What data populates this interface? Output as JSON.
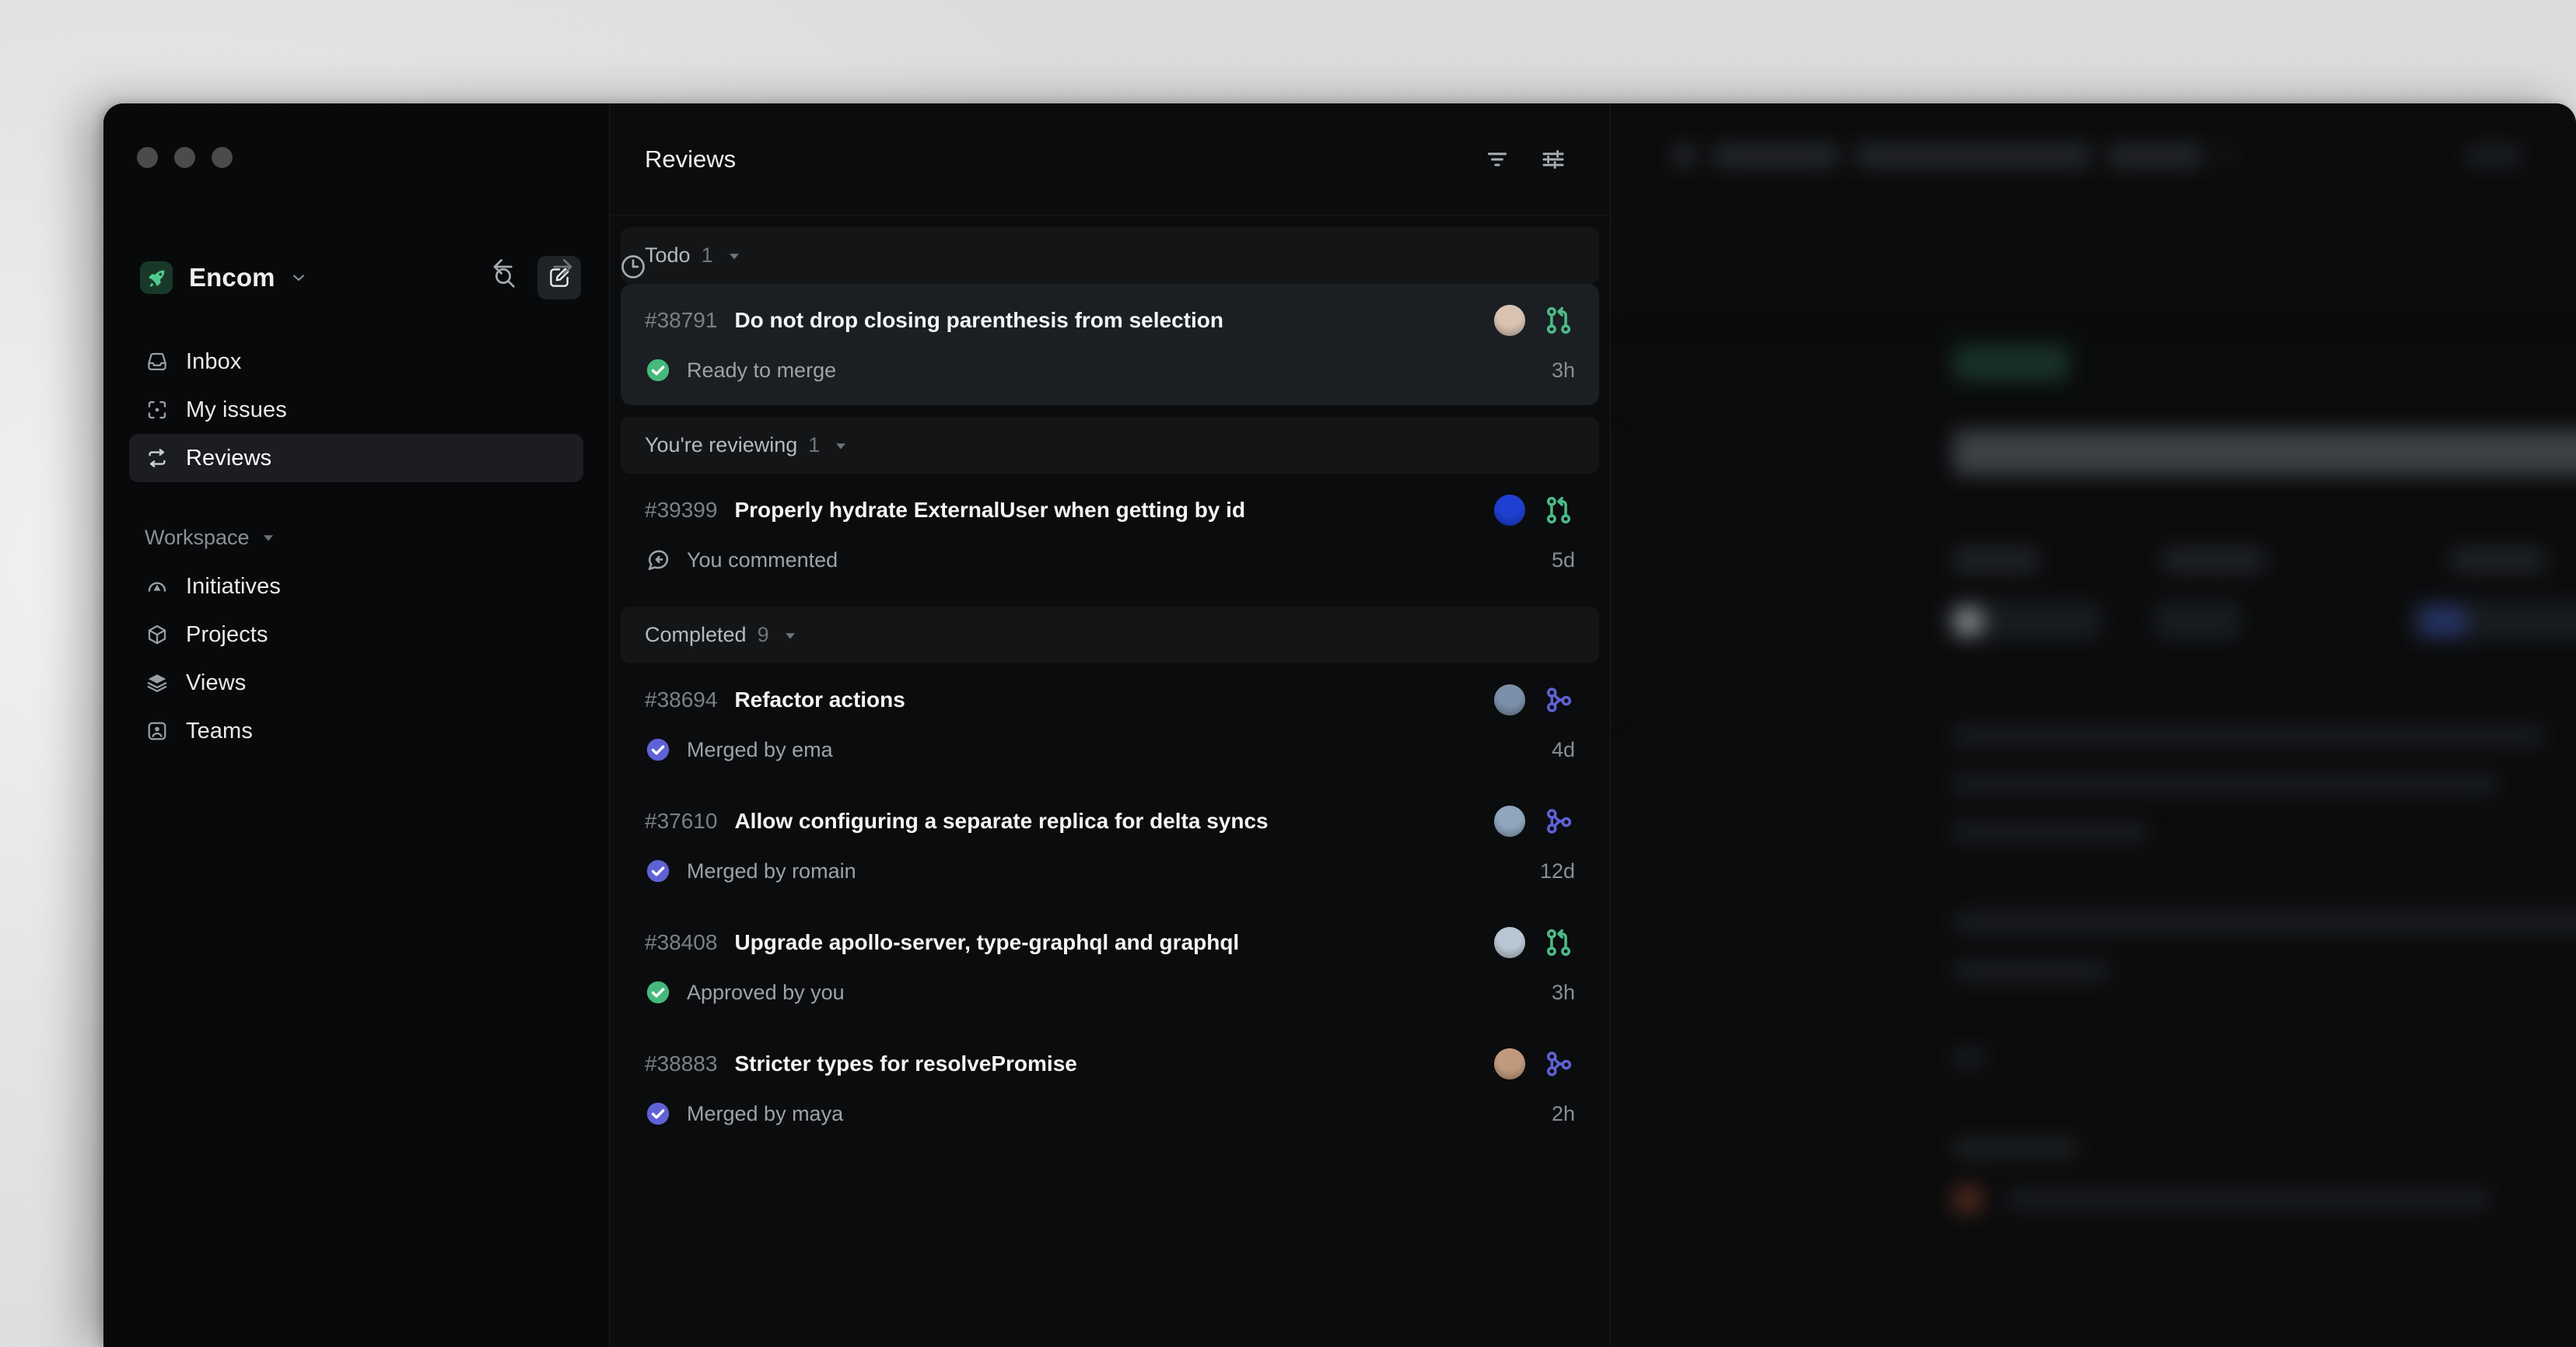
{
  "window": {
    "traffic_lights": [
      "close",
      "minimize",
      "maximize"
    ],
    "nav_back_icon": "arrow-left-icon",
    "nav_forward_icon": "arrow-right-icon",
    "history_icon": "clock-icon"
  },
  "sidebar": {
    "workspace": {
      "name": "Encom",
      "logo_icon": "rocket-icon",
      "logo_bg": "#18392a",
      "logo_fg": "#4fca8e",
      "caret_icon": "chevron-down-icon"
    },
    "search_icon": "search-icon",
    "compose_icon": "compose-icon",
    "nav_items": [
      {
        "label": "Inbox",
        "icon": "inbox-icon",
        "active": false
      },
      {
        "label": "My issues",
        "icon": "my-issues-icon",
        "active": false
      },
      {
        "label": "Reviews",
        "icon": "reviews-icon",
        "active": true
      }
    ],
    "section": {
      "label": "Workspace",
      "caret_icon": "caret-down-icon",
      "items": [
        {
          "label": "Initiatives",
          "icon": "initiatives-icon"
        },
        {
          "label": "Projects",
          "icon": "projects-icon"
        },
        {
          "label": "Views",
          "icon": "views-icon"
        },
        {
          "label": "Teams",
          "icon": "teams-icon"
        }
      ]
    }
  },
  "list": {
    "title": "Reviews",
    "filter_icon": "filter-icon",
    "display_options_icon": "sliders-icon",
    "groups": [
      {
        "title": "Todo",
        "count": "1",
        "caret_icon": "caret-down-icon",
        "items": [
          {
            "id": "#38791",
            "title": "Do not drop closing parenthesis from selection",
            "status": "Ready to merge",
            "status_icon": "check-circle-icon",
            "status_color": "#45b97c",
            "pr_icon": "pull-request-icon",
            "pr_color": "#4cbb87",
            "time": "3h",
            "avatar_color": "#d8c3b2",
            "selected": true
          }
        ]
      },
      {
        "title": "You're reviewing",
        "count": "1",
        "caret_icon": "caret-down-icon",
        "items": [
          {
            "id": "#39399",
            "title": "Properly hydrate ExternalUser when getting by id",
            "status": "You commented",
            "status_icon": "comment-reply-icon",
            "status_color": "#9ea2a7",
            "pr_icon": "pull-request-icon",
            "pr_color": "#4cbb87",
            "time": "5d",
            "avatar_color": "#1f3fd0",
            "selected": false
          }
        ]
      },
      {
        "title": "Completed",
        "count": "9",
        "caret_icon": "caret-down-icon",
        "items": [
          {
            "id": "#38694",
            "title": "Refactor actions",
            "status": "Merged by ema",
            "status_icon": "check-circle-icon",
            "status_color": "#5e62d6",
            "pr_icon": "merged-icon",
            "pr_color": "#5e62d6",
            "time": "4d",
            "avatar_color": "#7a8fa8",
            "selected": false
          },
          {
            "id": "#37610",
            "title": "Allow configuring a separate replica for delta syncs",
            "status": "Merged by romain",
            "status_icon": "check-circle-icon",
            "status_color": "#5e62d6",
            "pr_icon": "merged-icon",
            "pr_color": "#5e62d6",
            "time": "12d",
            "avatar_color": "#8fa6bd",
            "selected": false
          },
          {
            "id": "#38408",
            "title": "Upgrade apollo-server, type-graphql and graphql",
            "status": "Approved by you",
            "status_icon": "check-circle-icon",
            "status_color": "#45b97c",
            "pr_icon": "pull-request-icon",
            "pr_color": "#4cbb87",
            "time": "3h",
            "avatar_color": "#b9c6d4",
            "selected": false
          },
          {
            "id": "#38883",
            "title": "Stricter types for resolvePromise",
            "status": "Merged by maya",
            "status_icon": "check-circle-icon",
            "status_color": "#5e62d6",
            "pr_icon": "merged-icon",
            "pr_color": "#5e62d6",
            "time": "2h",
            "avatar_color": "#c19a7e",
            "selected": false
          }
        ]
      }
    ]
  },
  "detail": {
    "blurred": true
  }
}
